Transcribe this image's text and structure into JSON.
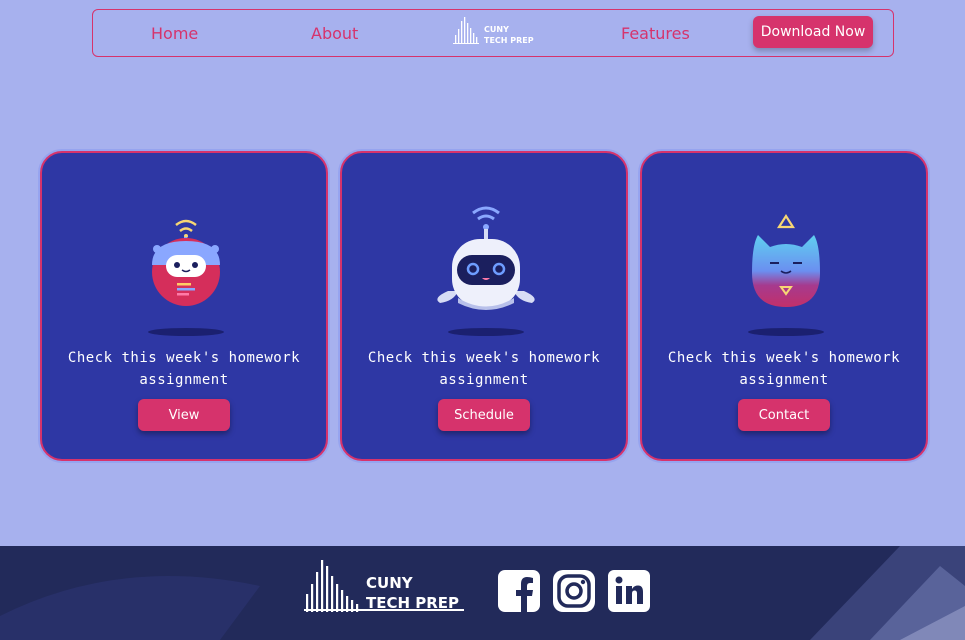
{
  "nav": {
    "home": "Home",
    "about": "About",
    "features": "Features",
    "download": "Download Now",
    "logo_line1": "CUNY",
    "logo_line2": "TECH PREP"
  },
  "cards": [
    {
      "text_line1": "Check this week's homework",
      "text_line2": "assignment",
      "button": "View",
      "icon": "robot-red-icon"
    },
    {
      "text_line1": "Check this week's homework",
      "text_line2": "assignment",
      "button": "Schedule",
      "icon": "robot-white-icon"
    },
    {
      "text_line1": "Check this week's homework",
      "text_line2": "assignment",
      "button": "Contact",
      "icon": "robot-cat-icon"
    }
  ],
  "footer": {
    "logo_line1": "CUNY",
    "logo_line2": "TECH PREP",
    "social": [
      "facebook-icon",
      "instagram-icon",
      "linkedin-icon"
    ]
  },
  "colors": {
    "background": "#a7b1ee",
    "card": "#2e37a4",
    "accent": "#d6336c",
    "footer": "#222a5a"
  }
}
